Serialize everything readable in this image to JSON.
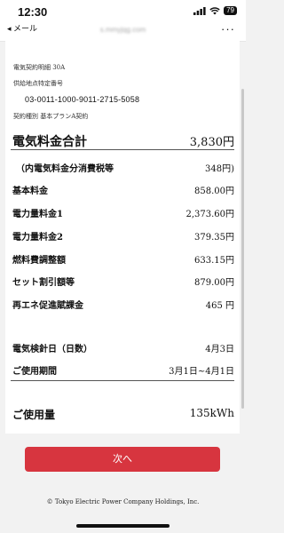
{
  "status": {
    "time": "12:30",
    "battery": "79"
  },
  "nav": {
    "back": "◂ メール",
    "url": "s.mmyjqg.com"
  },
  "bill": {
    "detail_title": "電気契約明細 30A",
    "supply_point_label": "供給地点特定番号",
    "supply_point_number": "03-0011-1000-9011-2715-5058",
    "contract_type": "契約種別 基本プランA契約",
    "total": {
      "label": "電気料金合計",
      "value": "3,830円"
    },
    "rows": [
      {
        "label": "（内電気料金分消費税等",
        "value": "348円)"
      },
      {
        "label": "基本料金",
        "value": "858.00円"
      },
      {
        "label": "電力量料金1",
        "value": "2,373.60円"
      },
      {
        "label": "電力量料金2",
        "value": "379.35円"
      },
      {
        "label": "燃料費調整額",
        "value": "633.15円"
      },
      {
        "label": "セット割引額等",
        "value": "879.00円"
      },
      {
        "label": "再エネ促進賦課金",
        "value": "465 円"
      }
    ],
    "meter_date": {
      "label": "電気検針日（日数）",
      "value": "4月3日"
    },
    "period": {
      "label": "ご使用期間",
      "value": "3月1日~4月1日"
    },
    "usage": {
      "label": "ご使用量",
      "value": "135kWh"
    }
  },
  "next_button": "次へ",
  "copyright": "© Tokyo Electric Power Company Holdings, Inc."
}
